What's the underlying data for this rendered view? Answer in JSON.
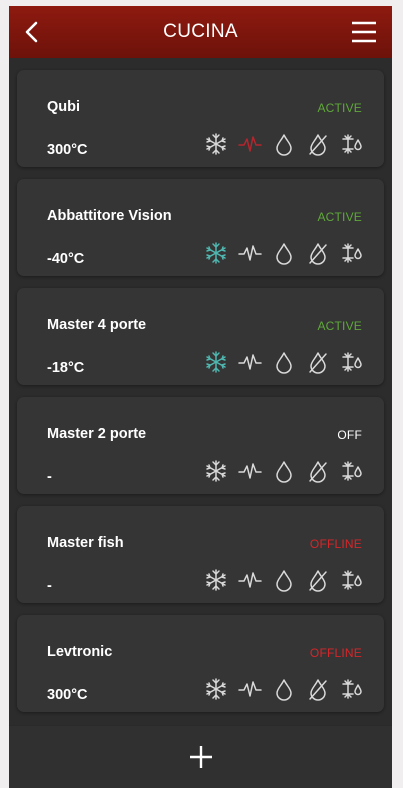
{
  "header": {
    "title": "CUCINA"
  },
  "colors": {
    "header_red": "#7f160d",
    "active": "#5fa83a",
    "off": "#ffffff",
    "offline": "#d6262a",
    "icon_inactive": "#d9d9d9",
    "icon_snow_active": "#4fb7b0",
    "icon_wave_active": "#b3262e"
  },
  "devices": [
    {
      "name": "Qubi",
      "status": "ACTIVE",
      "temp": "300°C"
    },
    {
      "name": "Abbattitore Vision",
      "status": "ACTIVE",
      "temp": "-40°C"
    },
    {
      "name": "Master 4 porte",
      "status": "ACTIVE",
      "temp": "-18°C"
    },
    {
      "name": "Master 2 porte",
      "status": "OFF",
      "temp": "-"
    },
    {
      "name": "Master fish",
      "status": "OFFLINE",
      "temp": "-"
    },
    {
      "name": "Levtronic",
      "status": "OFFLINE",
      "temp": "300°C"
    }
  ],
  "icons": [
    "snowflake-icon",
    "wave-icon",
    "drop-icon",
    "no-drop-icon",
    "fan-drop-icon"
  ],
  "footer": {
    "add_icon": "plus-icon"
  }
}
